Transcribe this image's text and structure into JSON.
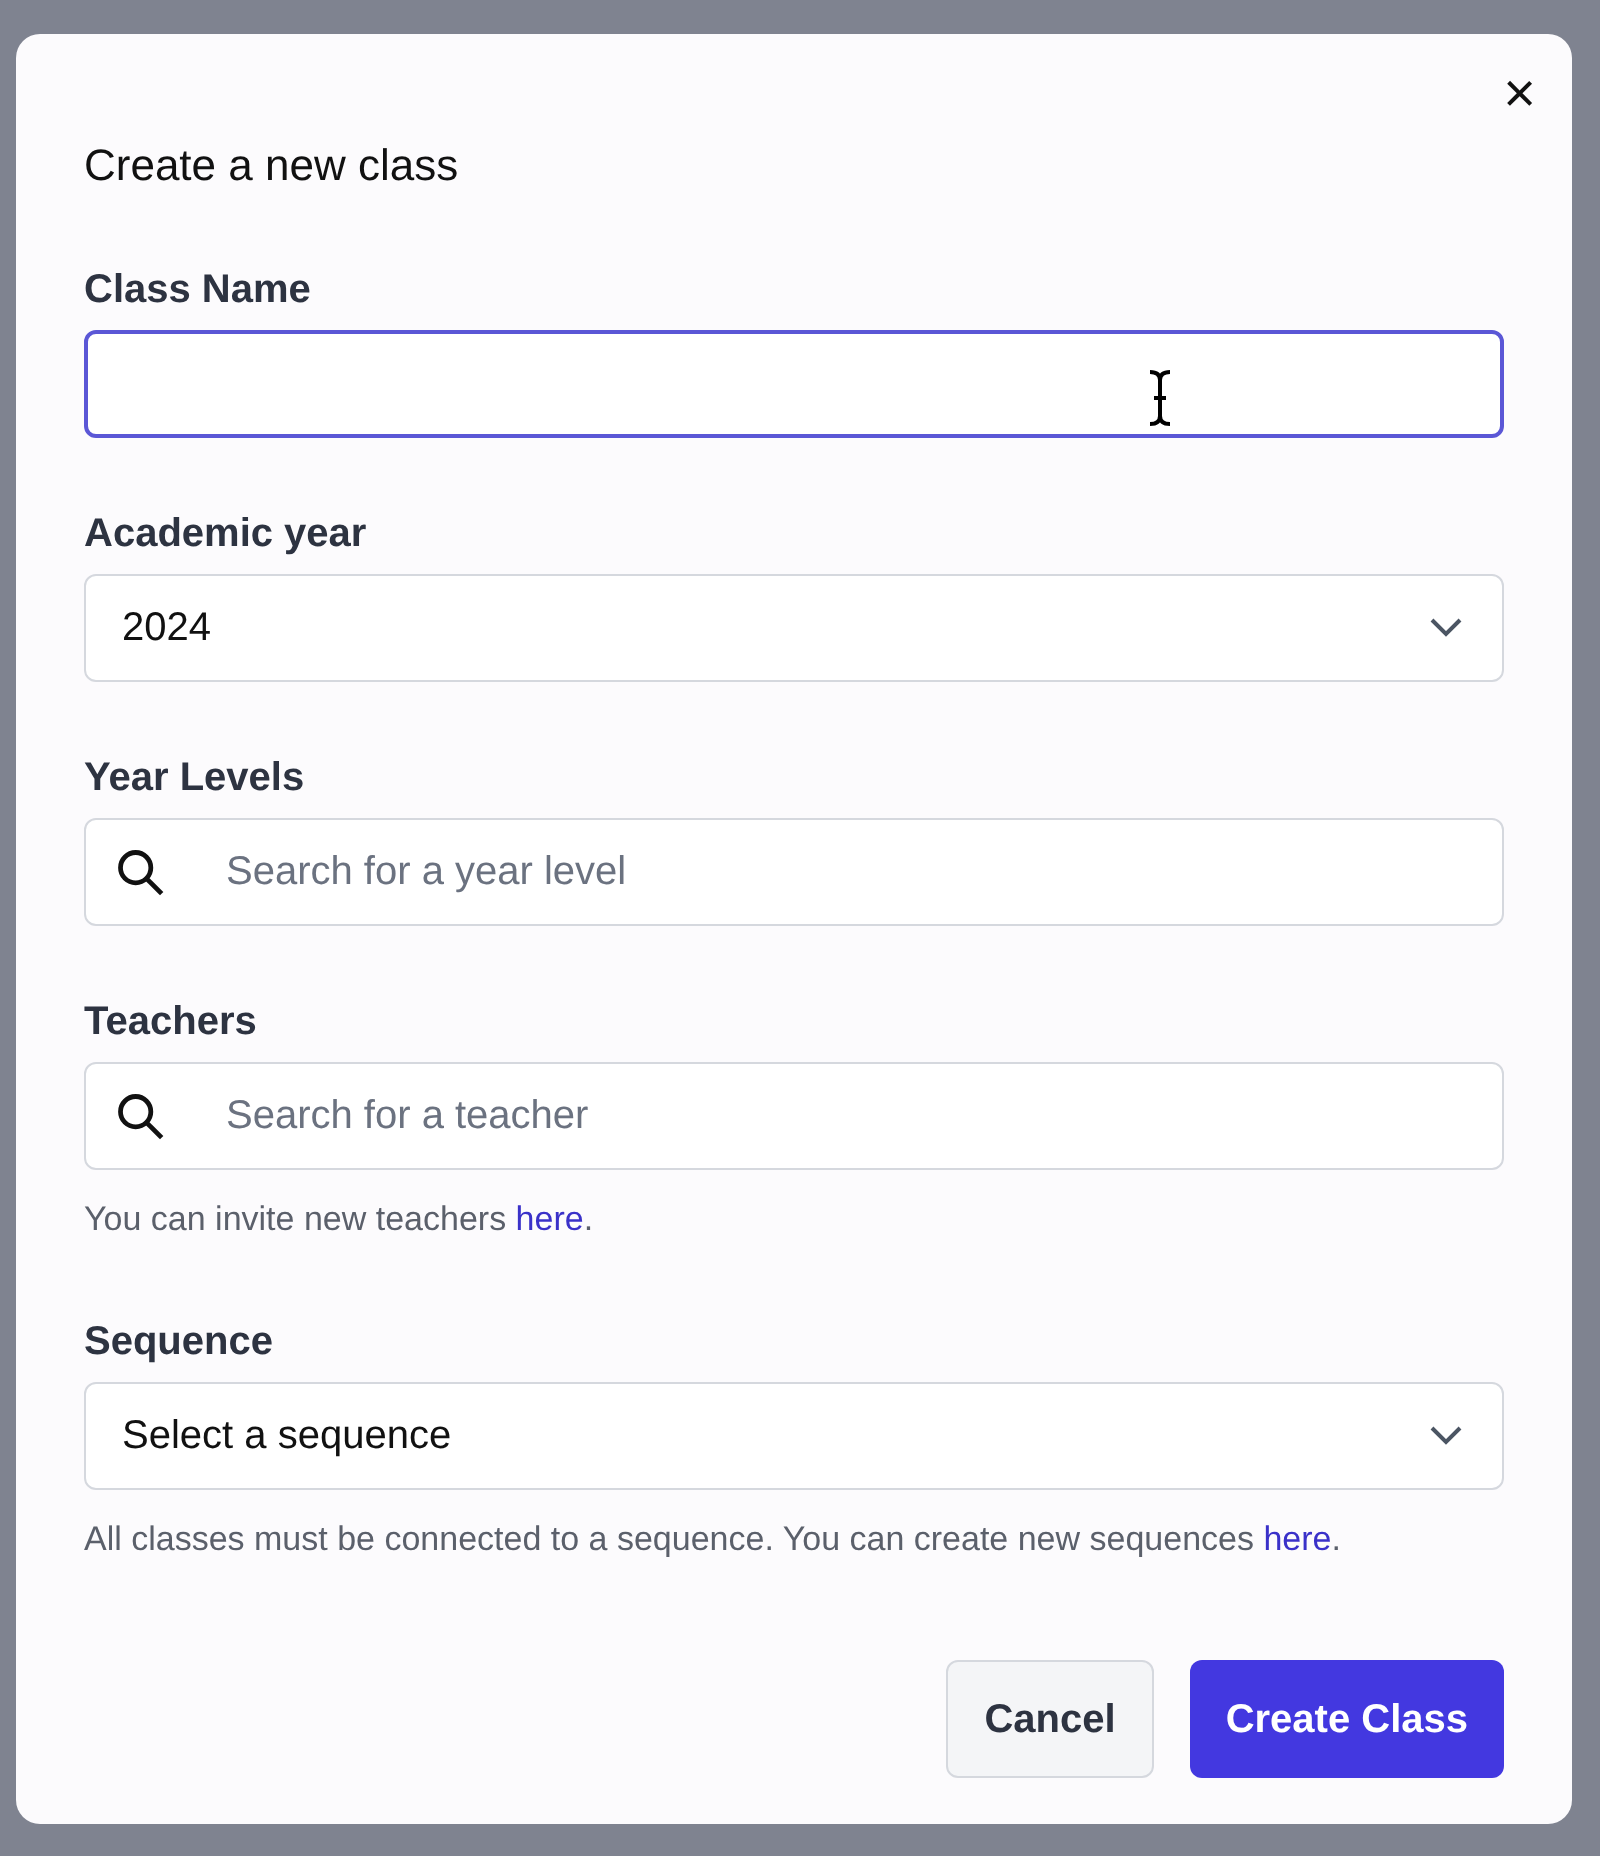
{
  "dialog": {
    "title": "Create a new class",
    "close": "×"
  },
  "fields": [
    {
      "kind": "text",
      "label": "Class Name",
      "focused": true
    },
    {
      "kind": "select",
      "label": "Academic year",
      "value": "2024",
      "focused": false
    },
    {
      "kind": "search",
      "label": "Year Levels",
      "placeholder": "Search for a year level",
      "focused": false
    },
    {
      "kind": "search",
      "label": "Teachers",
      "placeholder": "Search for a teacher",
      "focused": false,
      "help": {
        "text": "You can invite new teachers ",
        "link": "here",
        "after": "."
      }
    },
    {
      "kind": "select",
      "label": "Sequence",
      "value": "Select a sequence",
      "focused": false,
      "help": {
        "text": "All classes must be connected to a sequence. You can create new sequences ",
        "link": "here",
        "after": "."
      }
    }
  ],
  "buttons": [
    {
      "label": "Cancel",
      "kind": "secondary"
    },
    {
      "label": "Create Class",
      "kind": "primary"
    }
  ]
}
